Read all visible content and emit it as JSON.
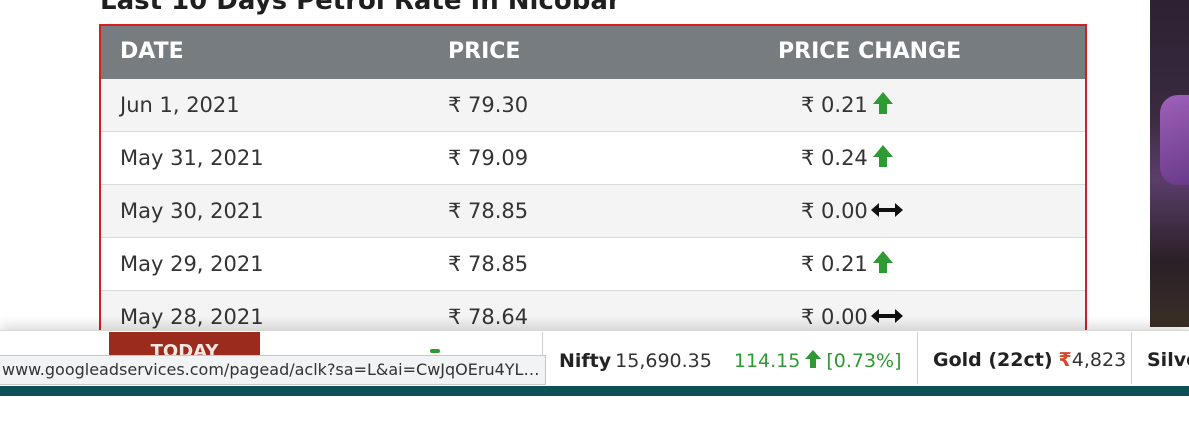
{
  "heading": "Last 10 Days Petrol Rate In Nicobar",
  "table": {
    "headers": {
      "date": "DATE",
      "price": "PRICE",
      "change": "PRICE CHANGE"
    },
    "rows": [
      {
        "date": "Jun 1, 2021",
        "price": "₹ 79.30",
        "change": "₹ 0.21",
        "indicator": "up-arrow-icon"
      },
      {
        "date": "May 31, 2021",
        "price": "₹ 79.09",
        "change": "₹ 0.24",
        "indicator": "up-arrow-icon"
      },
      {
        "date": "May 30, 2021",
        "price": "₹ 78.85",
        "change": "₹ 0.00",
        "indicator": "no-change-icon"
      },
      {
        "date": "May 29, 2021",
        "price": "₹ 78.85",
        "change": "₹ 0.21",
        "indicator": "up-arrow-icon"
      },
      {
        "date": "May 28, 2021",
        "price": "₹ 78.64",
        "change": "₹ 0.00",
        "indicator": "no-change-icon"
      }
    ]
  },
  "ticker": {
    "today_label": "TODAY",
    "nifty": {
      "label": "Nifty",
      "value": "15,690.35",
      "change": "114.15",
      "percent": "[0.73%]"
    },
    "gold": {
      "label": "Gold (22ct)",
      "currency": "₹",
      "value": "4,823"
    },
    "silver": {
      "label": "Silve"
    }
  },
  "status_bar": {
    "url": "www.googleadservices.com/pagead/aclk?sa=L&ai=CwJqOEru4YLS..."
  },
  "colors": {
    "header_bg": "#777c80",
    "up_green": "#2e9a34",
    "outline_red": "#d41f1f",
    "today_tab": "#9b2b1d"
  }
}
